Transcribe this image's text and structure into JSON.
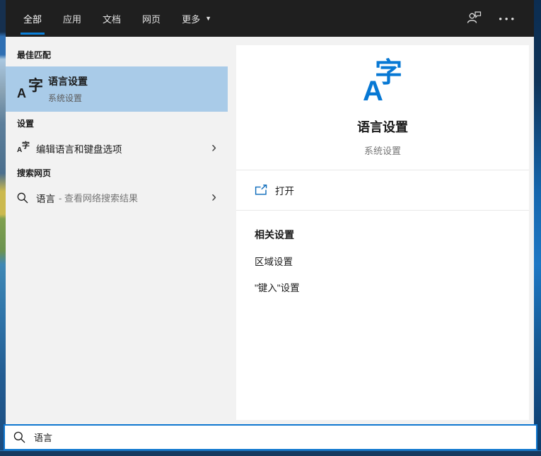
{
  "colors": {
    "accent": "#0078d7",
    "selection": "#a9cbe8",
    "topbar_bg": "#1f1f1f"
  },
  "topbar": {
    "tabs": [
      {
        "label": "全部",
        "selected": true
      },
      {
        "label": "应用",
        "selected": false
      },
      {
        "label": "文档",
        "selected": false
      },
      {
        "label": "网页",
        "selected": false
      },
      {
        "label": "更多",
        "selected": false,
        "has_dropdown": true
      }
    ]
  },
  "icon_glyph": {
    "letter": "A",
    "cjk": "字"
  },
  "left": {
    "best_match_header": "最佳匹配",
    "best_match": {
      "title": "语言设置",
      "subtitle": "系统设置"
    },
    "settings_header": "设置",
    "settings_item": {
      "title": "编辑语言和键盘选项"
    },
    "web_header": "搜索网页",
    "web_item": {
      "title": "语言",
      "suffix": "- 查看网络搜索结果"
    }
  },
  "preview": {
    "title": "语言设置",
    "subtitle": "系统设置",
    "open_label": "打开",
    "related_header": "相关设置",
    "related_items": [
      "区域设置",
      "\"键入\"设置"
    ]
  },
  "search": {
    "value": "语言"
  }
}
